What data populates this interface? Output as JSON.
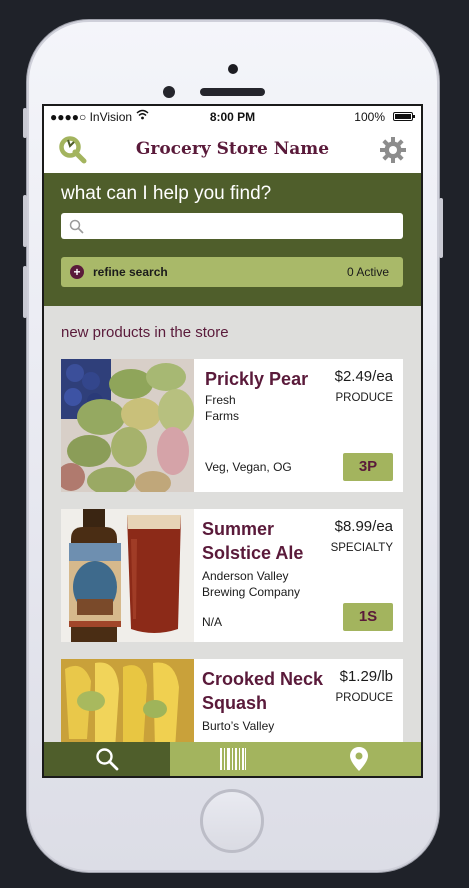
{
  "status_bar": {
    "carrier": "●●●●○ InVision",
    "time": "8:00 PM",
    "battery": "100%"
  },
  "header": {
    "title": "Grocery Store Name"
  },
  "search": {
    "prompt": "what can I help you find?",
    "placeholder": "",
    "refine_label": "refine search",
    "active_count": "0 Active"
  },
  "section": {
    "title": "new products in the store"
  },
  "products": [
    {
      "name": "Prickly Pear",
      "price": "$2.49/ea",
      "department": "PRODUCE",
      "vendor": "Fresh Farms",
      "tags": "Veg, Vegan, OG",
      "code": "3P"
    },
    {
      "name": "Summer Solstice Ale",
      "price": "$8.99/ea",
      "department": "SPECIALTY",
      "vendor": "Anderson Valley Brewing Company",
      "tags": "N/A",
      "code": "1S"
    },
    {
      "name": "Crooked Neck Squash",
      "price": "$1.29/lb",
      "department": "PRODUCE",
      "vendor": "Burto’s Valley",
      "tags": "",
      "code": ""
    }
  ],
  "bottom_tabs": [
    {
      "icon": "search-icon",
      "active": true
    },
    {
      "icon": "barcode-icon",
      "active": false
    },
    {
      "icon": "location-pin-icon",
      "active": false
    }
  ],
  "colors": {
    "olive_dark": "#4f5e2b",
    "olive_light": "#a3b45e",
    "plum": "#5a1a3a"
  }
}
